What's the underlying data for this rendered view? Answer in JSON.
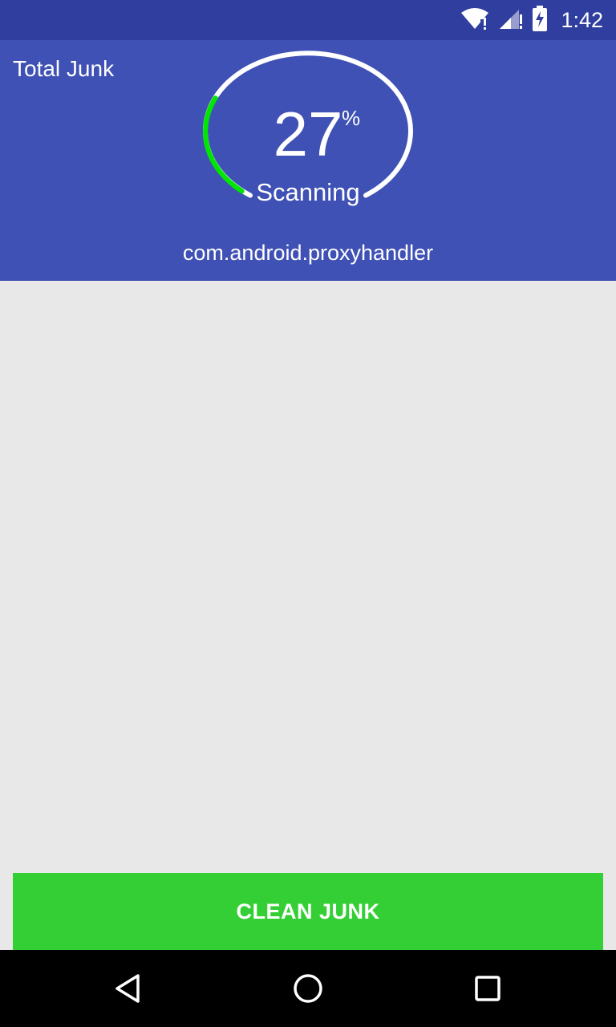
{
  "status_bar": {
    "time": "1:42",
    "icons": [
      "wifi-icon",
      "cell-signal-icon",
      "battery-charging-icon"
    ]
  },
  "header": {
    "title": "Total Junk",
    "progress_value": "27",
    "progress_unit": "%",
    "progress_fraction": 0.27,
    "status": "Scanning",
    "current_package": "com.android.proxyhandler"
  },
  "actions": {
    "clean_label": "CLEAN JUNK"
  },
  "nav": {
    "icons": [
      "back-icon",
      "home-icon",
      "recents-icon"
    ]
  },
  "colors": {
    "status_bar": "#303f9f",
    "header": "#3f51b5",
    "progress_arc": "#00e600",
    "button": "#34cf34",
    "background": "#e8e8e8"
  }
}
